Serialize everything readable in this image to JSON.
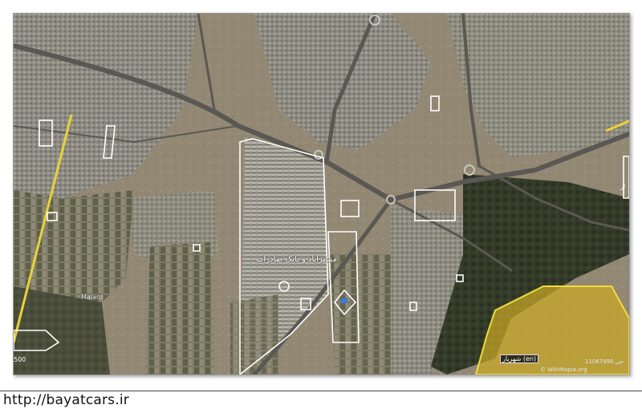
{
  "map": {
    "place_labels": {
      "malard": "Malard",
      "shahriar": "شهریار (en)",
      "center_arabic": "مشیرآباد و بانک صادرات",
      "right_edge": "ار"
    },
    "credit": "© WikiMapia.org",
    "id_text": "11067490 جی",
    "scale_text": "500"
  },
  "colors": {
    "highlight_yellow": "#e8d23a",
    "yellow_region_fill": "#c9a825",
    "outline_white": "#ffffff"
  },
  "footer": {
    "url": "http://bayatcars.ir"
  }
}
